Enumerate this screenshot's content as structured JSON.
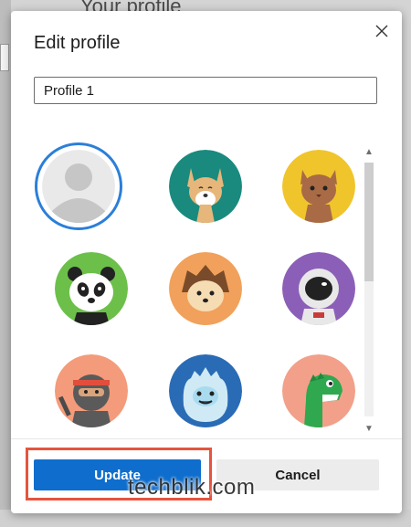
{
  "background": {
    "page_title": "Your profile"
  },
  "dialog": {
    "title": "Edit profile",
    "name_input": {
      "value": "Profile 1"
    },
    "avatars": [
      {
        "name": "default-silhouette",
        "selected": true,
        "bg": "#ffffff"
      },
      {
        "name": "fox",
        "selected": false,
        "bg": "#1a8a7e"
      },
      {
        "name": "cat",
        "selected": false,
        "bg": "#f0c52b"
      },
      {
        "name": "panda",
        "selected": false,
        "bg": "#6cc04a"
      },
      {
        "name": "hedgehog",
        "selected": false,
        "bg": "#f1a15b"
      },
      {
        "name": "astronaut",
        "selected": false,
        "bg": "#8b5fb7"
      },
      {
        "name": "ninja",
        "selected": false,
        "bg": "#f39b7a"
      },
      {
        "name": "yeti",
        "selected": false,
        "bg": "#2a6bb5"
      },
      {
        "name": "dinosaur",
        "selected": false,
        "bg": "#f2a08a"
      }
    ],
    "update_label": "Update",
    "cancel_label": "Cancel",
    "accent_color": "#0f6ecd",
    "highlight_color": "#e5543e"
  },
  "watermark": "techblik.com"
}
